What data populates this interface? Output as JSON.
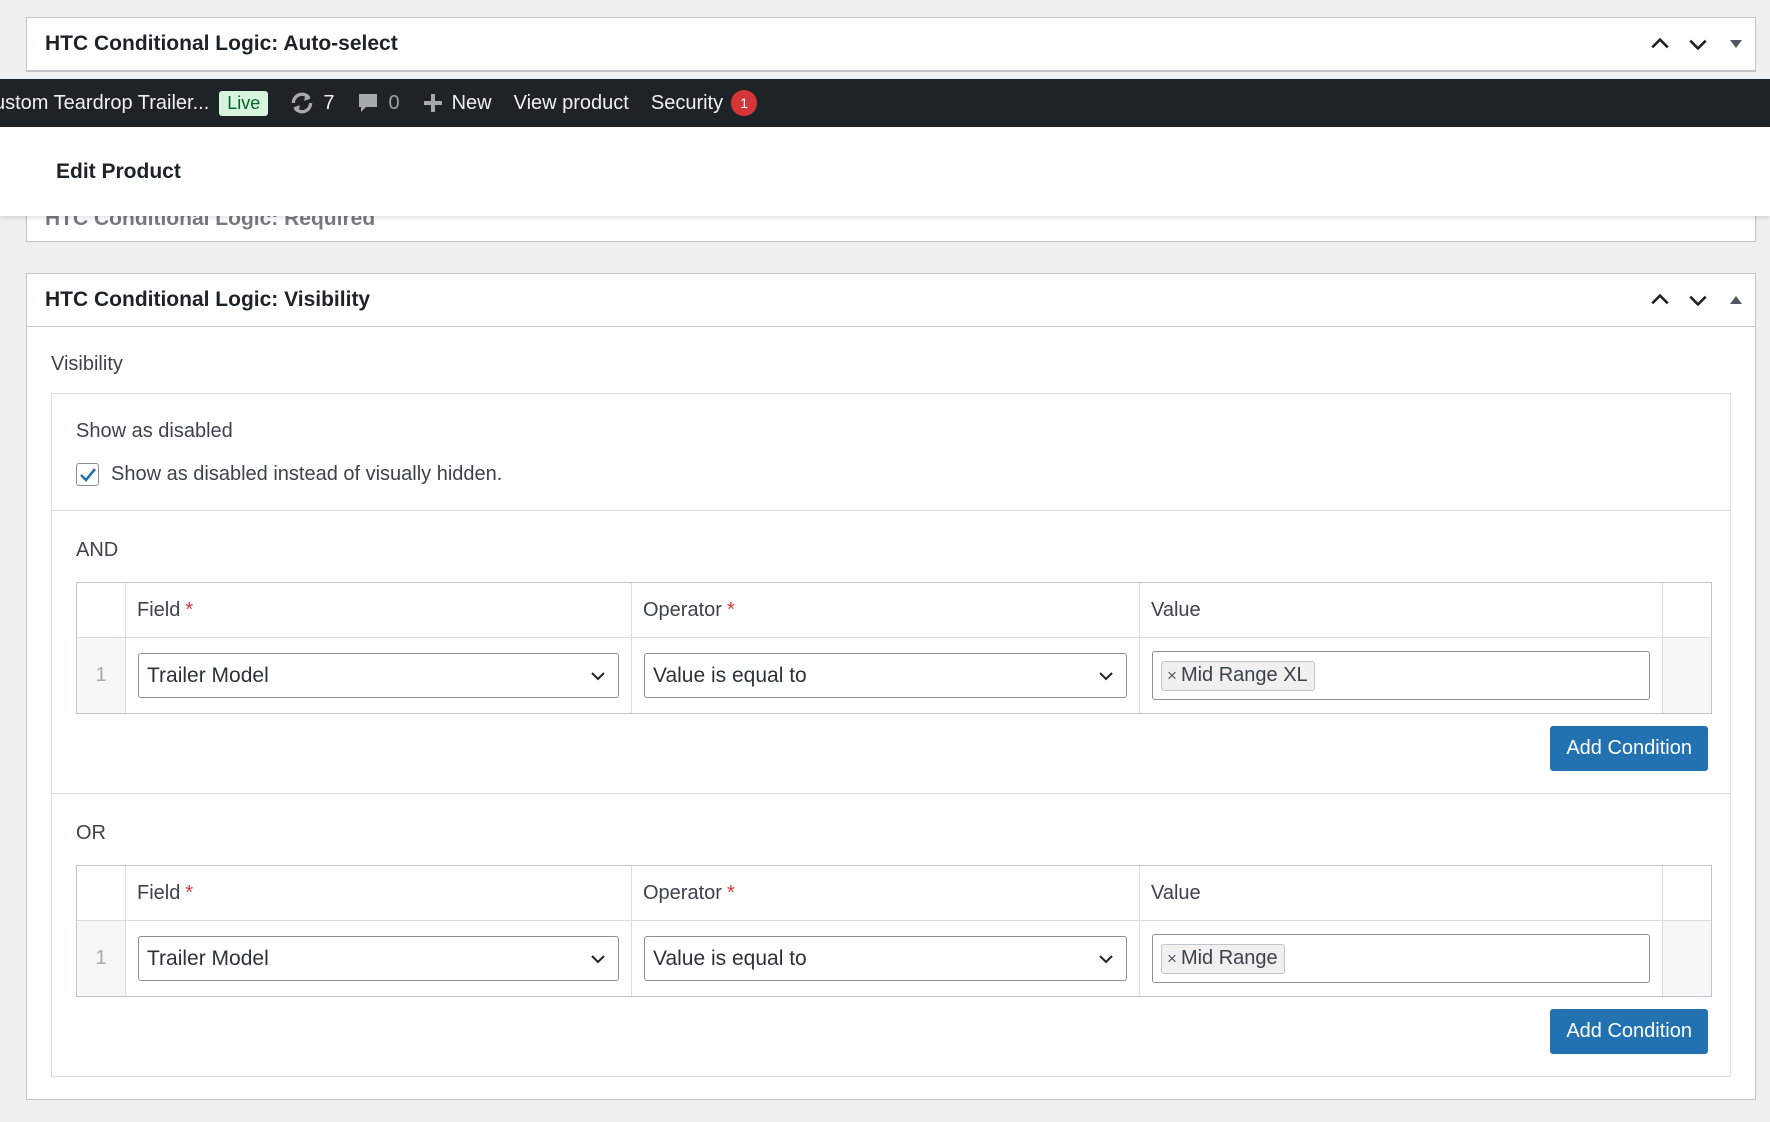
{
  "boxes": {
    "autoselect_title": "HTC Conditional Logic: Auto-select",
    "required_title": "HTC Conditional Logic: Required",
    "visibility_title": "HTC Conditional Logic: Visibility"
  },
  "adminbar": {
    "site_name": "ustom Teardrop Trailer...",
    "live_label": "Live",
    "updates_count": "7",
    "comments_count": "0",
    "new_label": "New",
    "view_product_label": "View product",
    "security_label": "Security",
    "security_count": "1"
  },
  "edit_header": {
    "title": "Edit Product"
  },
  "visibility": {
    "section_label": "Visibility",
    "show_disabled_heading": "Show as disabled",
    "show_disabled_checkbox_label": "Show as disabled instead of visually hidden.",
    "show_disabled_checked": true,
    "groups": [
      {
        "label": "AND",
        "headers": {
          "field": "Field",
          "operator": "Operator",
          "value": "Value",
          "required_mark": "*"
        },
        "rows": [
          {
            "index": "1",
            "field": "Trailer Model",
            "operator": "Value is equal to",
            "value_tag": "Mid Range XL"
          }
        ],
        "add_label": "Add Condition"
      },
      {
        "label": "OR",
        "headers": {
          "field": "Field",
          "operator": "Operator",
          "value": "Value",
          "required_mark": "*"
        },
        "rows": [
          {
            "index": "1",
            "field": "Trailer Model",
            "operator": "Value is equal to",
            "value_tag": "Mid Range"
          }
        ],
        "add_label": "Add Condition"
      }
    ]
  },
  "colors": {
    "adminbar_bg": "#1d2327",
    "primary_button": "#2271b1",
    "required_star": "#d63638",
    "security_badge": "#d63638",
    "checkbox_check": "#2271b1"
  },
  "icons": {
    "move_up": "chevron-up-icon",
    "move_down": "chevron-down-icon",
    "toggle": "triangle-toggle-icon",
    "updates": "refresh-icon",
    "comments": "comment-icon",
    "new": "plus-icon",
    "select_arrow": "chevron-down-icon",
    "tag_remove": "×"
  }
}
